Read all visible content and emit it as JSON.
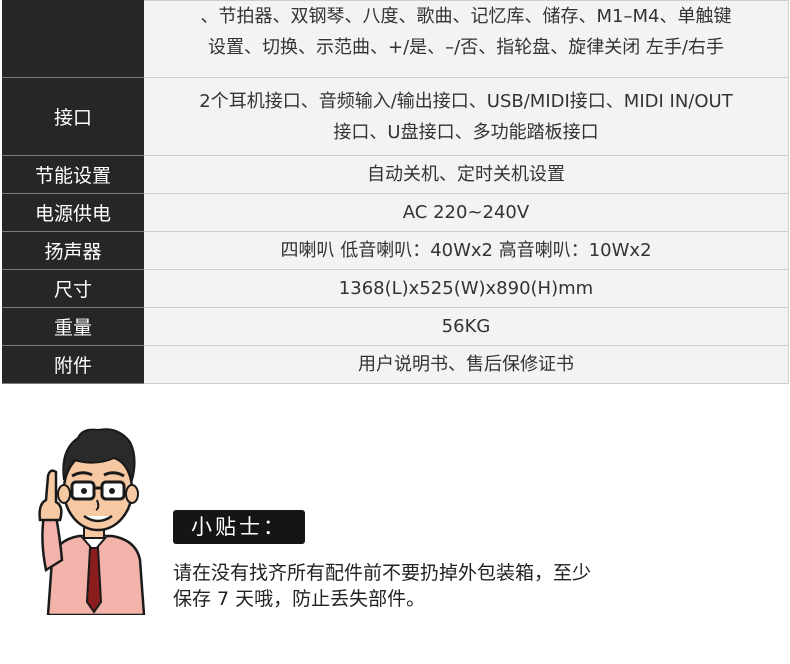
{
  "spec_table": {
    "rows": [
      {
        "label": "",
        "value_lines": [
          "、节拍器、双钢琴、八度、歌曲、记忆库、储存、M1–M4、单触键",
          "设置、切换、示范曲、+/是、–/否、指轮盘、旋律关闭 左手/右手"
        ]
      },
      {
        "label": "接口",
        "value_lines": [
          "2个耳机接口、音频输入/输出接口、USB/MIDI接口、MIDI IN/OUT",
          "接口、U盘接口、多功能踏板接口"
        ]
      },
      {
        "label": "节能设置",
        "value_lines": [
          "自动关机、定时关机设置"
        ]
      },
      {
        "label": "电源供电",
        "value_lines": [
          "AC 220~240V"
        ]
      },
      {
        "label": "扬声器",
        "value_lines": [
          "四喇叭 低音喇叭：40Wx2 高音喇叭：10Wx2"
        ]
      },
      {
        "label": "尺寸",
        "value_lines": [
          "1368(L)x525(W)x890(H)mm"
        ]
      },
      {
        "label": "重量",
        "value_lines": [
          "56KG"
        ]
      },
      {
        "label": "附件",
        "value_lines": [
          "用户说明书、售后保修证书"
        ]
      }
    ]
  },
  "tips": {
    "badge": "小贴士：",
    "lines": [
      "请在没有找齐所有配件前不要扔掉外包装箱，至少",
      "保存 7 天哦，防止丢失部件。"
    ]
  },
  "colors": {
    "label_bg": "#262626",
    "value_bg": "#f3f3f3",
    "badge_bg": "#151515"
  },
  "icons": {
    "mascot": "cartoon-man-raising-finger"
  }
}
